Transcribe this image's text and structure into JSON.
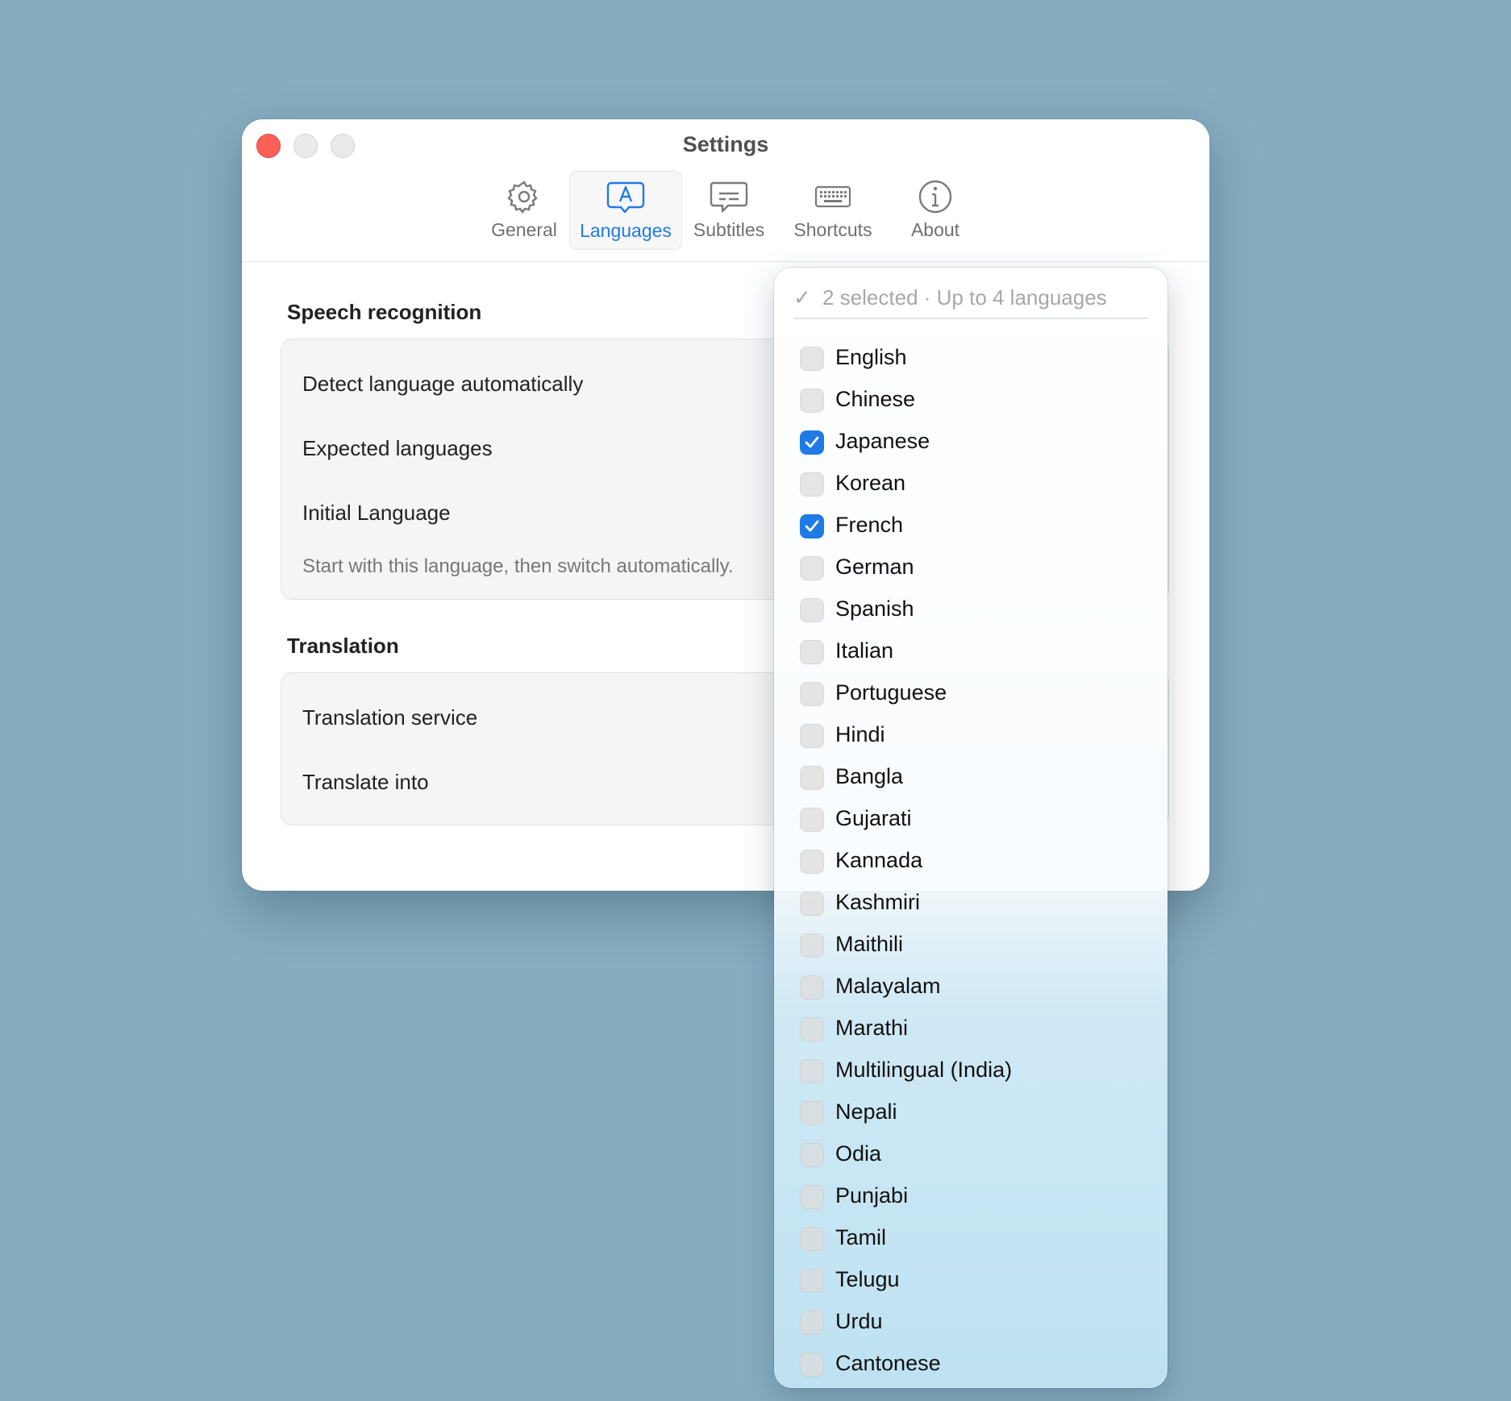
{
  "window": {
    "title": "Settings"
  },
  "tabs": [
    {
      "label": "General",
      "icon": "gear-icon"
    },
    {
      "label": "Languages",
      "icon": "language-icon",
      "active": true
    },
    {
      "label": "Subtitles",
      "icon": "subtitles-icon"
    },
    {
      "label": "Shortcuts",
      "icon": "keyboard-icon"
    },
    {
      "label": "About",
      "icon": "info-icon"
    }
  ],
  "speech_recognition": {
    "title": "Speech recognition",
    "rows": {
      "detect": "Detect language automatically",
      "expected": "Expected languages",
      "initial": "Initial Language",
      "initial_hint": "Start with this language, then switch automatically."
    }
  },
  "translation": {
    "title": "Translation",
    "rows": {
      "service": "Translation service",
      "into": "Translate into"
    }
  },
  "dropdown": {
    "header": "2 selected · Up to 4 languages",
    "options": [
      {
        "label": "English",
        "checked": false
      },
      {
        "label": "Chinese",
        "checked": false
      },
      {
        "label": "Japanese",
        "checked": true
      },
      {
        "label": "Korean",
        "checked": false
      },
      {
        "label": "French",
        "checked": true
      },
      {
        "label": "German",
        "checked": false
      },
      {
        "label": "Spanish",
        "checked": false
      },
      {
        "label": "Italian",
        "checked": false
      },
      {
        "label": "Portuguese",
        "checked": false
      },
      {
        "label": "Hindi",
        "checked": false
      },
      {
        "label": "Bangla",
        "checked": false
      },
      {
        "label": "Gujarati",
        "checked": false
      },
      {
        "label": "Kannada",
        "checked": false
      },
      {
        "label": "Kashmiri",
        "checked": false
      },
      {
        "label": "Maithili",
        "checked": false
      },
      {
        "label": "Malayalam",
        "checked": false
      },
      {
        "label": "Marathi",
        "checked": false
      },
      {
        "label": "Multilingual (India)",
        "checked": false
      },
      {
        "label": "Nepali",
        "checked": false
      },
      {
        "label": "Odia",
        "checked": false
      },
      {
        "label": "Punjabi",
        "checked": false
      },
      {
        "label": "Tamil",
        "checked": false
      },
      {
        "label": "Telugu",
        "checked": false
      },
      {
        "label": "Urdu",
        "checked": false
      },
      {
        "label": "Cantonese",
        "checked": false
      }
    ]
  },
  "colors": {
    "accent": "#1f7ae6",
    "close": "#fe5f57",
    "background": "#86adbf"
  }
}
